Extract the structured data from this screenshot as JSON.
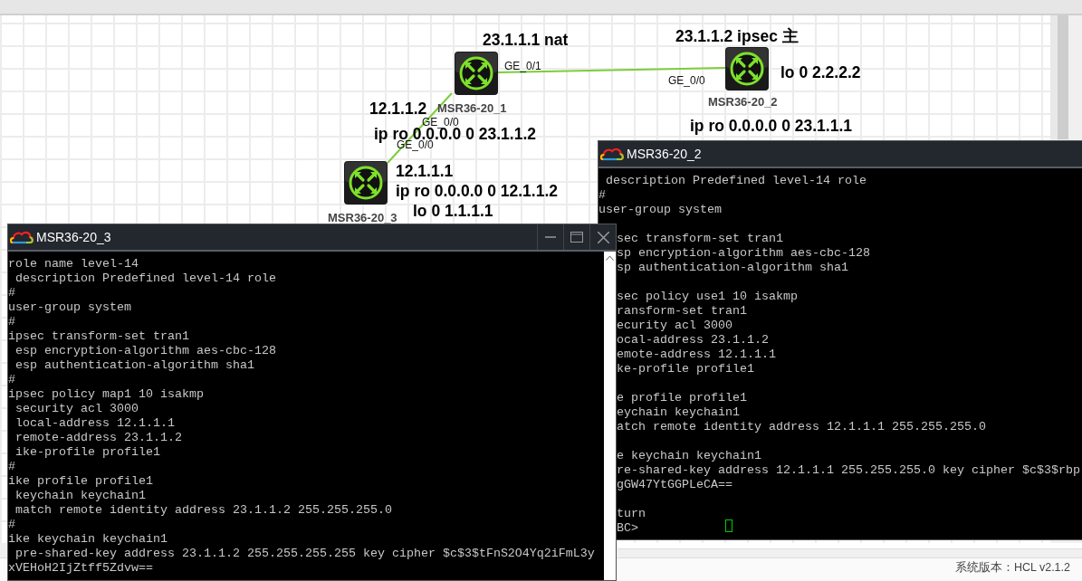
{
  "canvas": {
    "nodes": [
      {
        "name": "MSR36-20_1"
      },
      {
        "name": "MSR36-20_2"
      },
      {
        "name": "MSR36-20_3"
      }
    ],
    "ports": [
      "GE_0/1",
      "GE_0/0",
      "GE_0/0",
      "GE_0/0"
    ],
    "notes": [
      "23.1.1.1 nat",
      "23.1.1.2 ipsec 主",
      "lo 0 2.2.2.2",
      "ip ro 0.0.0.0 0 23.1.1.1",
      "12.1.1.2",
      "ip ro 0.0.0.0 0 23.1.1.2",
      "12.1.1.1",
      "ip ro 0.0.0.0 0 12.1.1.2",
      "lo 0 1.1.1.1"
    ]
  },
  "windows": [
    {
      "title": "MSR36-20_2",
      "controls": false,
      "blocks": [
        [
          " description Predefined level-14 role",
          "#",
          "user-group system"
        ],
        [
          "sec transform-set tran1",
          "sp encryption-algorithm aes-cbc-128",
          "sp authentication-algorithm sha1"
        ],
        [
          "sec policy use1 10 isakmp",
          "ransform-set tran1",
          "ecurity acl 3000",
          "ocal-address 23.1.1.2",
          "emote-address 12.1.1.1",
          "ke-profile profile1"
        ],
        [
          "e profile profile1",
          "eychain keychain1",
          "atch remote identity address 12.1.1.1 255.255.255.0"
        ],
        [
          "e keychain keychain1",
          "re-shared-key address 12.1.1.1 255.255.255.0 key cipher $c$3$rbp",
          "gGW47YtGGPLeCA=="
        ],
        [
          "turn",
          "BC>"
        ]
      ]
    },
    {
      "title": "MSR36-20_3",
      "controls": true,
      "blocks": [
        [
          "role name level-14",
          " description Predefined level-14 role",
          "#",
          "user-group system",
          "#",
          "ipsec transform-set tran1",
          " esp encryption-algorithm aes-cbc-128",
          " esp authentication-algorithm sha1",
          "#",
          "ipsec policy map1 10 isakmp",
          " security acl 3000",
          " local-address 12.1.1.1",
          " remote-address 23.1.1.2",
          " ike-profile profile1",
          "#",
          "ike profile profile1",
          " keychain keychain1",
          " match remote identity address 23.1.1.2 255.255.255.0",
          "#",
          "ike keychain keychain1",
          " pre-shared-key address 23.1.1.2 255.255.255.255 key cipher $c$3$tFnS2O4Yq2iFmL3y",
          "xVEHoH2IjZtff5Zdvw=="
        ]
      ]
    }
  ],
  "status_bar": {
    "version": "系统版本：HCL v2.1.2"
  }
}
